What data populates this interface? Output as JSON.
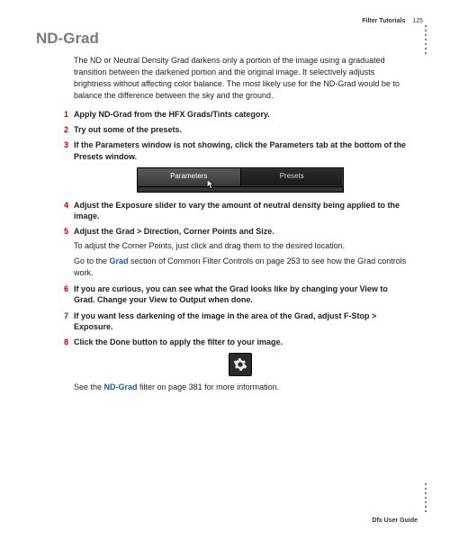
{
  "header": {
    "chapter": "Filter Tutorials",
    "page": "125"
  },
  "title": "ND-Grad",
  "intro": "The ND or Neutral Density Grad darkens only a portion of the image using a graduated transition between the darkened portion and the original image. It selectively adjusts brightness without affecting color balance. The most likely use for the ND-Grad would be to balance the difference between the sky and the ground.",
  "steps": {
    "s1": "Apply ND-Grad from the HFX Grads/Tints category.",
    "s2": "Try out some of the presets.",
    "s3": "If the Parameters window is not showing, click the Parameters tab at the bottom of the Presets window.",
    "s4": "Adjust the Exposure slider to vary the amount of neutral density being applied to the image.",
    "s5": "Adjust the Grad > Direction, Corner Points and Size.",
    "s5_sub1": "To adjust the Corner Points, just click and drag them to the desired location.",
    "s5_sub2a": "Go to the ",
    "s5_sub2_link": "Grad",
    "s5_sub2b": " section of Common Filter Controls on page 253 to see how the Grad controls work.",
    "s6": "If you are curious, you can see what the Grad looks like by changing your View to Grad. Change your View to Output when done.",
    "s7": "If you want less darkening of the image in the area of the Grad, adjust F-Stop > Exposure.",
    "s8": "Click the Done button to apply the filter to your image."
  },
  "tabs": {
    "parameters": "Parameters",
    "presets": "Presets"
  },
  "closing_a": "See the ",
  "closing_link": "ND-Grad",
  "closing_b": " filter on page 381 for more information.",
  "footer": "Dfx User Guide"
}
